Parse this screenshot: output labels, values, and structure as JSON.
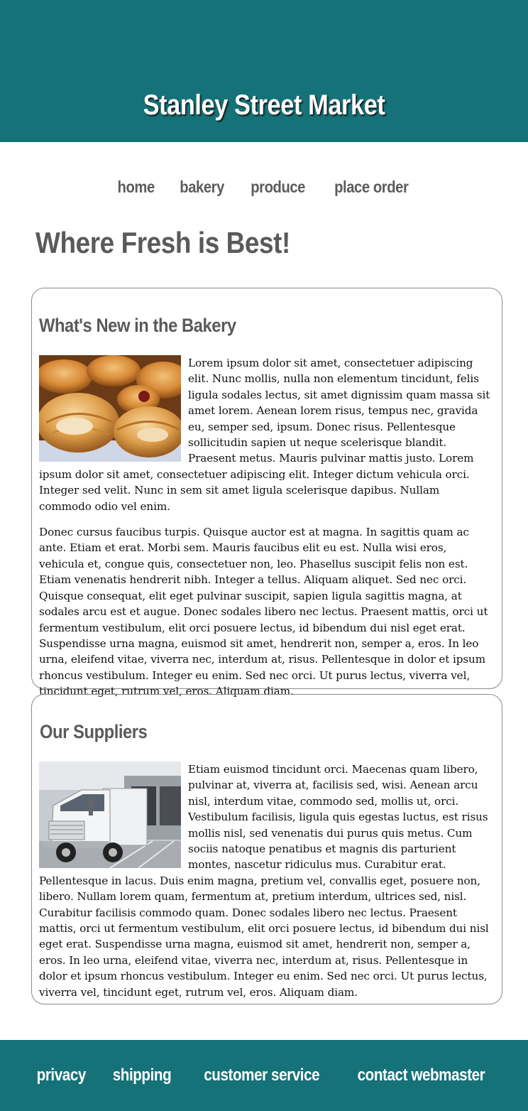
{
  "site": {
    "title": "Stanley Street Market"
  },
  "nav": [
    {
      "label": "home"
    },
    {
      "label": "bakery"
    },
    {
      "label": "produce"
    },
    {
      "label": "place order"
    }
  ],
  "tagline": "Where Fresh is Best!",
  "sections": {
    "bakery": {
      "heading": "What's New in the Bakery",
      "image": "pastries-photo",
      "paragraphs": [
        "Lorem ipsum dolor sit amet, consectetuer adipiscing elit. Nunc mollis, nulla non elementum tincidunt, felis ligula sodales lectus, sit amet dignissim quam massa sit amet lorem. Aenean lorem risus, tempus nec, gravida eu, semper sed, ipsum. Donec risus. Pellentesque sollicitudin sapien ut neque scelerisque blandit. Praesent metus. Mauris pulvinar mattis justo. Lorem ipsum dolor sit amet, consectetuer adipiscing elit. Integer dictum vehicula orci. Integer sed velit. Nunc in sem sit amet ligula scelerisque dapibus. Nullam commodo odio vel enim.",
        "Donec cursus faucibus turpis. Quisque auctor est at magna. In sagittis quam ac ante. Etiam et erat. Morbi sem. Mauris faucibus elit eu est. Nulla wisi eros, vehicula et, congue quis, consectetuer non, leo. Phasellus suscipit felis non est. Etiam venenatis hendrerit nibh. Integer a tellus. Aliquam aliquet. Sed nec orci. Quisque consequat, elit eget pulvinar suscipit, sapien ligula sagittis magna, at sodales arcu est et augue. Donec sodales libero nec lectus. Praesent mattis, orci ut fermentum vestibulum, elit orci posuere lectus, id bibendum dui nisl eget erat. Suspendisse urna magna, euismod sit amet, hendrerit non, semper a, eros. In leo urna, eleifend vitae, viverra nec, interdum at, risus. Pellentesque in dolor et ipsum rhoncus vestibulum. Integer eu enim. Sed nec orci. Ut purus lectus, viverra vel, tincidunt eget, rutrum vel, eros. Aliquam diam."
      ]
    },
    "suppliers": {
      "heading": "Our Suppliers",
      "image": "delivery-truck-photo",
      "paragraphs": [
        "Etiam euismod tincidunt orci. Maecenas quam libero, pulvinar at, viverra at, facilisis sed, wisi. Aenean arcu nisl, interdum vitae, commodo sed, mollis ut, orci. Vestibulum facilisis, ligula quis egestas luctus, est risus mollis nisl, sed venenatis dui purus quis metus. Cum sociis natoque penatibus et magnis dis parturient montes, nascetur ridiculus mus. Curabitur erat. Pellentesque in lacus. Duis enim magna, pretium vel, convallis eget, posuere non, libero. Nullam lorem quam, fermentum at, pretium interdum, ultrices sed, nisl. Curabitur facilisis commodo quam. Donec sodales libero nec lectus. Praesent mattis, orci ut fermentum vestibulum, elit orci posuere lectus, id bibendum dui nisl eget erat. Suspendisse urna magna, euismod sit amet, hendrerit non, semper a, eros. In leo urna, eleifend vitae, viverra nec, interdum at, risus. Pellentesque in dolor et ipsum rhoncus vestibulum. Integer eu enim. Sed nec orci. Ut purus lectus, viverra vel, tincidunt eget, rutrum vel, eros. Aliquam diam."
      ]
    }
  },
  "footer": [
    {
      "label": "privacy"
    },
    {
      "label": "shipping"
    },
    {
      "label": "customer service"
    },
    {
      "label": "contact webmaster"
    }
  ],
  "colors": {
    "brand_teal": "#157279",
    "heading_gray": "#5a5a5a",
    "border_gray": "#8a8a8a"
  }
}
